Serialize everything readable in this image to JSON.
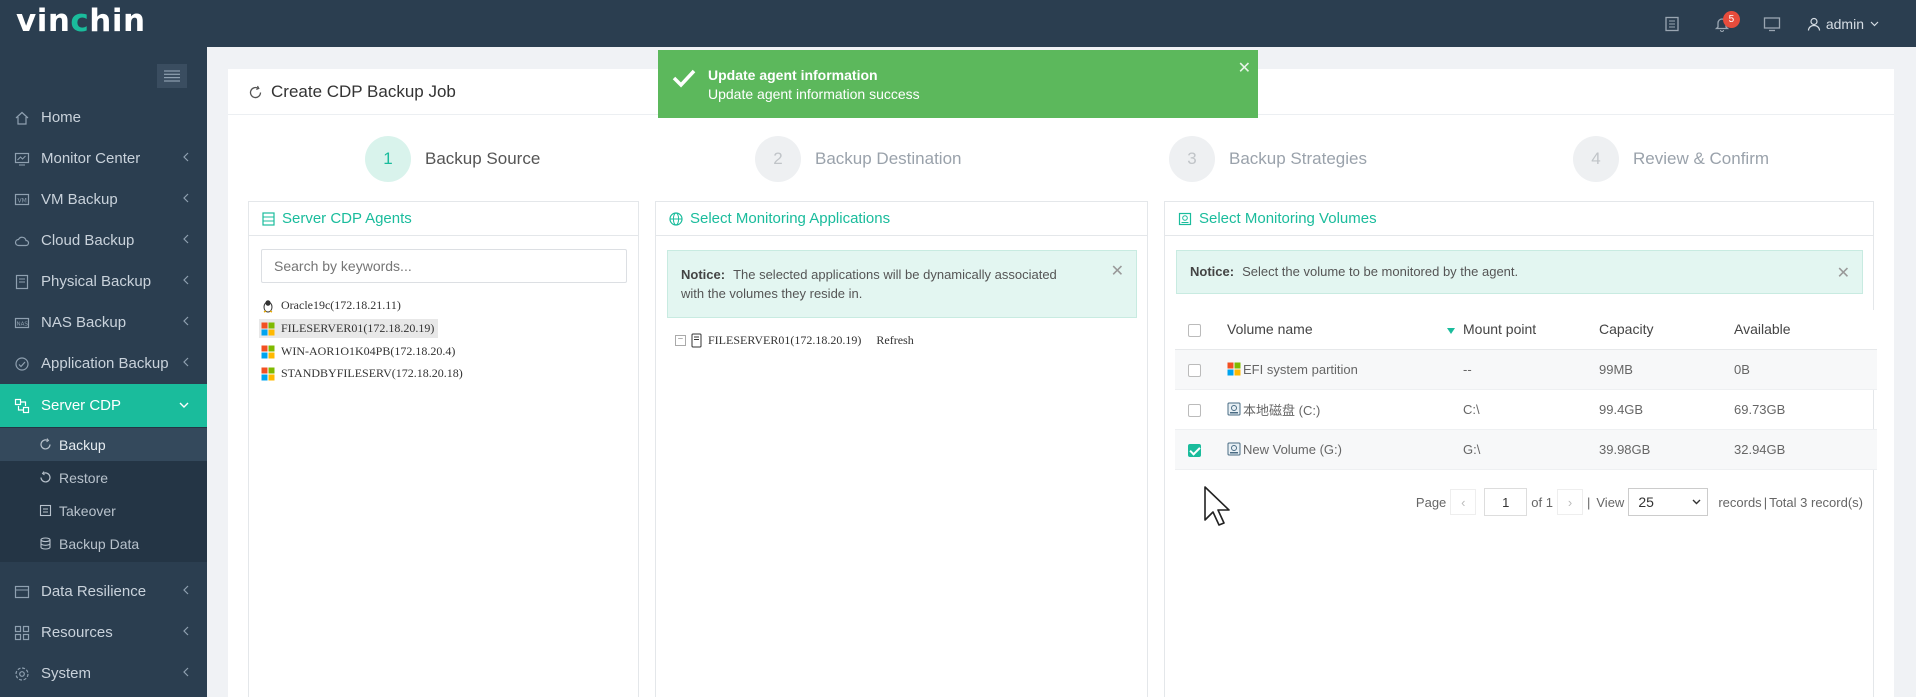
{
  "app": {
    "logo_prefix": "vin",
    "logo_accent": "c",
    "logo_suffix": "hin",
    "accent_color": "#1abc9c",
    "nav_bg": "#2b3e50"
  },
  "header": {
    "notification_count": "5",
    "user": "admin",
    "icons": [
      "tasks-icon",
      "bell-icon",
      "monitor-icon",
      "user-icon"
    ]
  },
  "sidebar": {
    "items": [
      {
        "label": "Home",
        "icon": "home-icon"
      },
      {
        "label": "Monitor Center",
        "icon": "monitor-center-icon"
      },
      {
        "label": "VM Backup",
        "icon": "vm-icon"
      },
      {
        "label": "Cloud Backup",
        "icon": "cloud-icon"
      },
      {
        "label": "Physical Backup",
        "icon": "physical-icon"
      },
      {
        "label": "NAS Backup",
        "icon": "nas-icon"
      },
      {
        "label": "Application Backup",
        "icon": "application-icon"
      },
      {
        "label": "Server CDP",
        "icon": "cdp-icon"
      },
      {
        "label": "Data Resilience",
        "icon": "resilience-icon"
      },
      {
        "label": "Resources",
        "icon": "resources-icon"
      },
      {
        "label": "System",
        "icon": "system-icon"
      }
    ],
    "subitems": [
      {
        "label": "Backup",
        "icon": "backup-icon"
      },
      {
        "label": "Restore",
        "icon": "restore-icon"
      },
      {
        "label": "Takeover",
        "icon": "takeover-icon"
      },
      {
        "label": "Backup Data",
        "icon": "database-icon"
      }
    ]
  },
  "page": {
    "title": "Create CDP Backup Job"
  },
  "steps": [
    {
      "num": "1",
      "label": "Backup Source"
    },
    {
      "num": "2",
      "label": "Backup Destination"
    },
    {
      "num": "3",
      "label": "Backup Strategies"
    },
    {
      "num": "4",
      "label": "Review & Confirm"
    }
  ],
  "agents_panel": {
    "title": "Server CDP Agents",
    "search_placeholder": "Search by keywords...",
    "agents": [
      {
        "label": "Oracle19c(172.18.21.11)",
        "os": "linux"
      },
      {
        "label": "FILESERVER01(172.18.20.19)",
        "os": "windows",
        "selected": true
      },
      {
        "label": "WIN-AOR1O1K04PB(172.18.20.4)",
        "os": "windows"
      },
      {
        "label": "STANDBYFILESERV(172.18.20.18)",
        "os": "windows"
      }
    ]
  },
  "apps_panel": {
    "title": "Select Monitoring Applications",
    "notice_label": "Notice:",
    "notice_text": "The selected applications will be dynamically associated with the volumes they reside in.",
    "tree_node": "FILESERVER01(172.18.20.19)",
    "refresh": "Refresh"
  },
  "volumes_panel": {
    "title": "Select Monitoring Volumes",
    "notice_label": "Notice:",
    "notice_text": "Select the volume to be monitored by the agent.",
    "columns": [
      "Volume name",
      "Mount point",
      "Capacity",
      "Available"
    ],
    "rows": [
      {
        "name": "EFI system partition",
        "mount": "--",
        "capacity": "99MB",
        "available": "0B",
        "checked": false
      },
      {
        "name": "本地磁盘 (C:)",
        "mount": "C:\\",
        "capacity": "99.4GB",
        "available": "69.73GB",
        "checked": false
      },
      {
        "name": "New Volume (G:)",
        "mount": "G:\\",
        "capacity": "39.98GB",
        "available": "32.94GB",
        "checked": true
      }
    ],
    "pager": {
      "page_label": "Page",
      "page": "1",
      "of": "of 1",
      "sep": "|",
      "view_label": "View",
      "per_page": "25",
      "records": "records",
      "total": "Total 3 record(s)"
    }
  },
  "toast": {
    "title": "Update agent information",
    "message": "Update agent information success",
    "color": "#5cb85c"
  }
}
